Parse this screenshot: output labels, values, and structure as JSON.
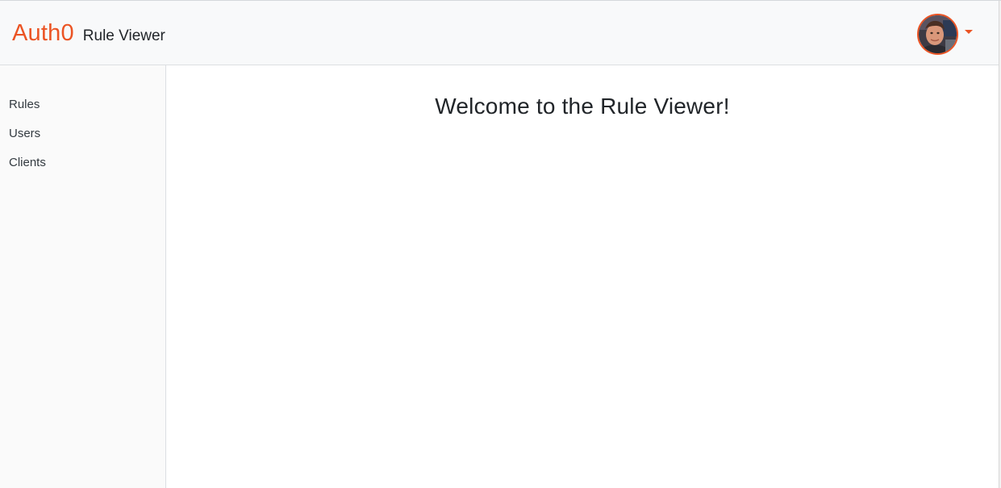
{
  "header": {
    "brand": "Auth0",
    "title": "Rule Viewer",
    "user_menu": {
      "avatar_icon": "user-avatar-photo",
      "caret_icon": "caret-down-icon"
    }
  },
  "sidebar": {
    "items": [
      {
        "label": "Rules"
      },
      {
        "label": "Users"
      },
      {
        "label": "Clients"
      }
    ]
  },
  "main": {
    "heading": "Welcome to the Rule Viewer!"
  },
  "colors": {
    "accent": "#eb5424",
    "navbar_bg": "#f8f9fa",
    "sidebar_bg": "#fafafa",
    "text": "#212529"
  }
}
